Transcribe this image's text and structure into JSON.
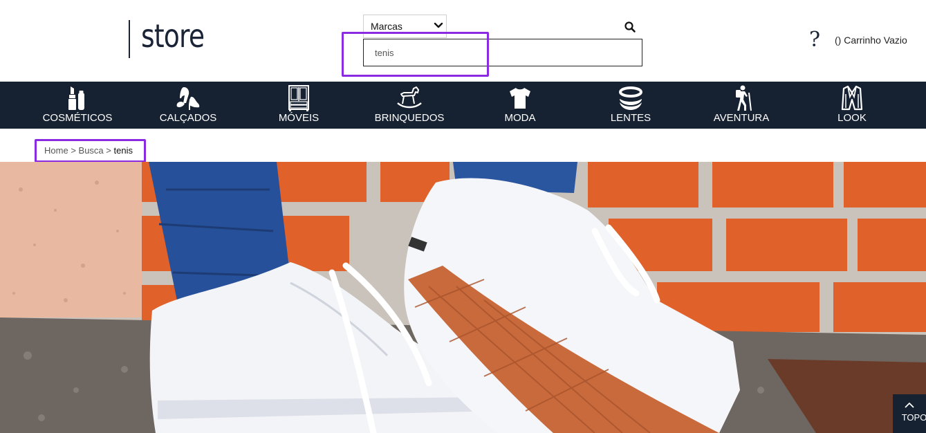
{
  "header": {
    "logo_text": "store",
    "brand_select": {
      "selected": "Marcas",
      "options": [
        "Marcas"
      ]
    },
    "search": {
      "value": "tenis",
      "icon": "search-icon"
    },
    "help": {
      "glyph": "?",
      "icon": "question-mark-icon"
    },
    "cart": {
      "label": "() Carrinho Vazio"
    }
  },
  "nav": {
    "items": [
      {
        "label": "COSMÉTICOS",
        "icon": "cosmetics-icon"
      },
      {
        "label": "CALÇADOS",
        "icon": "shoes-icon"
      },
      {
        "label": "MÓVEIS",
        "icon": "furniture-icon"
      },
      {
        "label": "BRINQUEDOS",
        "icon": "rocking-horse-icon"
      },
      {
        "label": "MODA",
        "icon": "tshirt-icon"
      },
      {
        "label": "LENTES",
        "icon": "contact-lens-icon"
      },
      {
        "label": "AVENTURA",
        "icon": "hiker-icon"
      },
      {
        "label": "LOOK",
        "icon": "blazer-icon"
      }
    ]
  },
  "breadcrumb": {
    "home": "Home",
    "separator": ">",
    "search": "Busca",
    "current": "tenis"
  },
  "hero": {
    "subject": "white sneakers against orange brick wall"
  },
  "back_to_top": {
    "label": "TOPO",
    "icon": "chevron-up-icon"
  },
  "colors": {
    "navbar": "#162131",
    "highlight": "#8a2be2",
    "brick": "#e0622a"
  }
}
